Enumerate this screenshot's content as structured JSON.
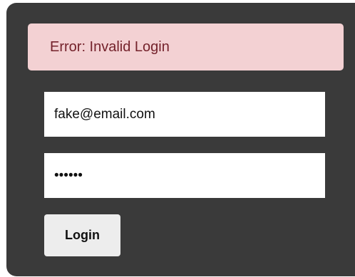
{
  "error": {
    "message": "Error: Invalid Login",
    "background": "#f3d1d3",
    "text_color": "#74222b"
  },
  "form": {
    "email_value": "fake@email.com",
    "password_value": "••••••",
    "login_label": "Login"
  },
  "colors": {
    "panel_background": "#3a3a3a",
    "field_background": "#ffffff",
    "button_background": "#ededed"
  }
}
